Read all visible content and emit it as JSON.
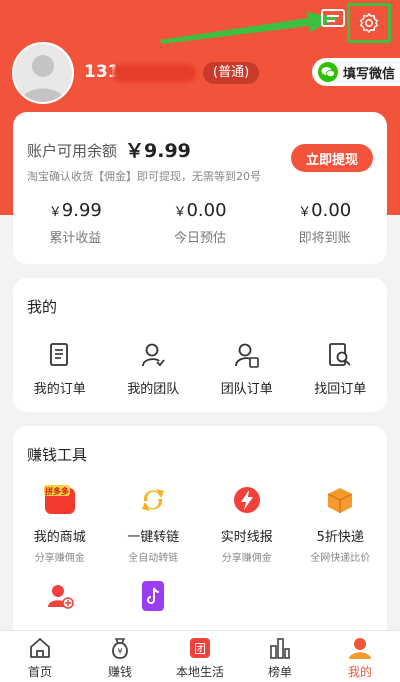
{
  "header": {
    "phone_prefix": "131",
    "level": "(普通)",
    "wechat_label": "填写微信"
  },
  "balance": {
    "label": "账户可用余额",
    "value": "￥9.99",
    "note": "淘宝确认收货【佣金】即可提现，无需等到20号",
    "withdraw_label": "立即提现",
    "stats": [
      {
        "value": "9.99",
        "label": "累计收益"
      },
      {
        "value": "0.00",
        "label": "今日预估"
      },
      {
        "value": "0.00",
        "label": "即将到账"
      }
    ],
    "currency": "￥"
  },
  "mine": {
    "title": "我的",
    "items": [
      {
        "label": "我的订单",
        "icon": "orders-icon"
      },
      {
        "label": "我的团队",
        "icon": "team-icon"
      },
      {
        "label": "团队订单",
        "icon": "team-orders-icon"
      },
      {
        "label": "找回订单",
        "icon": "find-order-icon"
      }
    ]
  },
  "tools": {
    "title": "赚钱工具",
    "items": [
      {
        "label": "我的商城",
        "sub": "分享赚佣金",
        "icon": "pinduoduo-icon",
        "badge": "拼多多"
      },
      {
        "label": "一键转链",
        "sub": "全自动转链",
        "icon": "convert-link-icon"
      },
      {
        "label": "实时线报",
        "sub": "分享赚佣金",
        "icon": "flash-news-icon"
      },
      {
        "label": "5折快递",
        "sub": "全网快递比价",
        "icon": "express-box-icon"
      }
    ]
  },
  "tabbar": {
    "items": [
      {
        "label": "首页",
        "icon": "home-icon"
      },
      {
        "label": "赚钱",
        "icon": "money-bag-icon"
      },
      {
        "label": "本地生活",
        "icon": "group-buy-icon",
        "badge": "团"
      },
      {
        "label": "榜单",
        "icon": "ranking-icon"
      },
      {
        "label": "我的",
        "icon": "profile-icon"
      }
    ],
    "active": "我的"
  },
  "colors": {
    "brand": "#f2543b",
    "highlight_box": "#3fbf3f"
  }
}
